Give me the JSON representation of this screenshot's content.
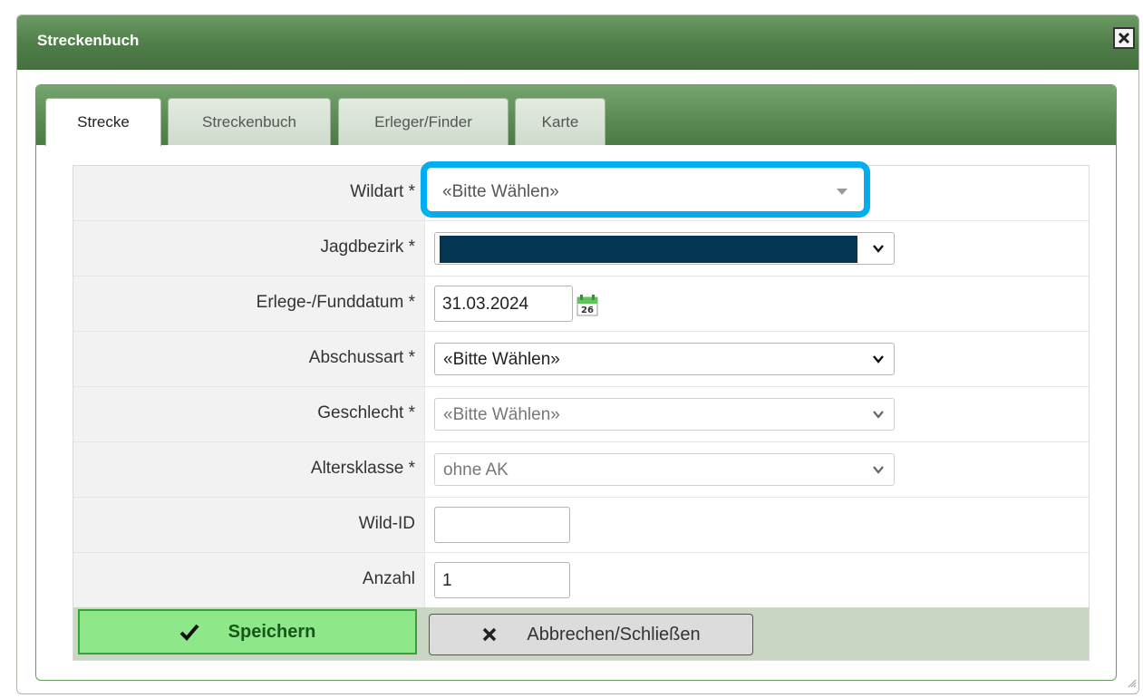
{
  "dialog": {
    "title": "Streckenbuch"
  },
  "tabs": [
    {
      "label": "Strecke"
    },
    {
      "label": "Streckenbuch"
    },
    {
      "label": "Erleger/Finder"
    },
    {
      "label": "Karte"
    }
  ],
  "form": {
    "wildart": {
      "label": "Wildart *",
      "value": "«Bitte Wählen»"
    },
    "jagdbezirk": {
      "label": "Jagdbezirk *",
      "value": ""
    },
    "datum": {
      "label": "Erlege-/Funddatum *",
      "value": "31.03.2024",
      "calendar_day": "26"
    },
    "abschussart": {
      "label": "Abschussart *",
      "value": "«Bitte Wählen»"
    },
    "geschlecht": {
      "label": "Geschlecht *",
      "value": "«Bitte Wählen»"
    },
    "altersklasse": {
      "label": "Altersklasse *",
      "value": "ohne AK"
    },
    "wild_id": {
      "label": "Wild-ID",
      "value": ""
    },
    "anzahl": {
      "label": "Anzahl",
      "value": "1"
    }
  },
  "buttons": {
    "save": "Speichern",
    "cancel": "Abbrechen/Schließen"
  },
  "colors": {
    "titlebar": "#4f7d48",
    "highlight": "#00aef0",
    "save": "#8ee88a",
    "redacted": "#043552"
  }
}
